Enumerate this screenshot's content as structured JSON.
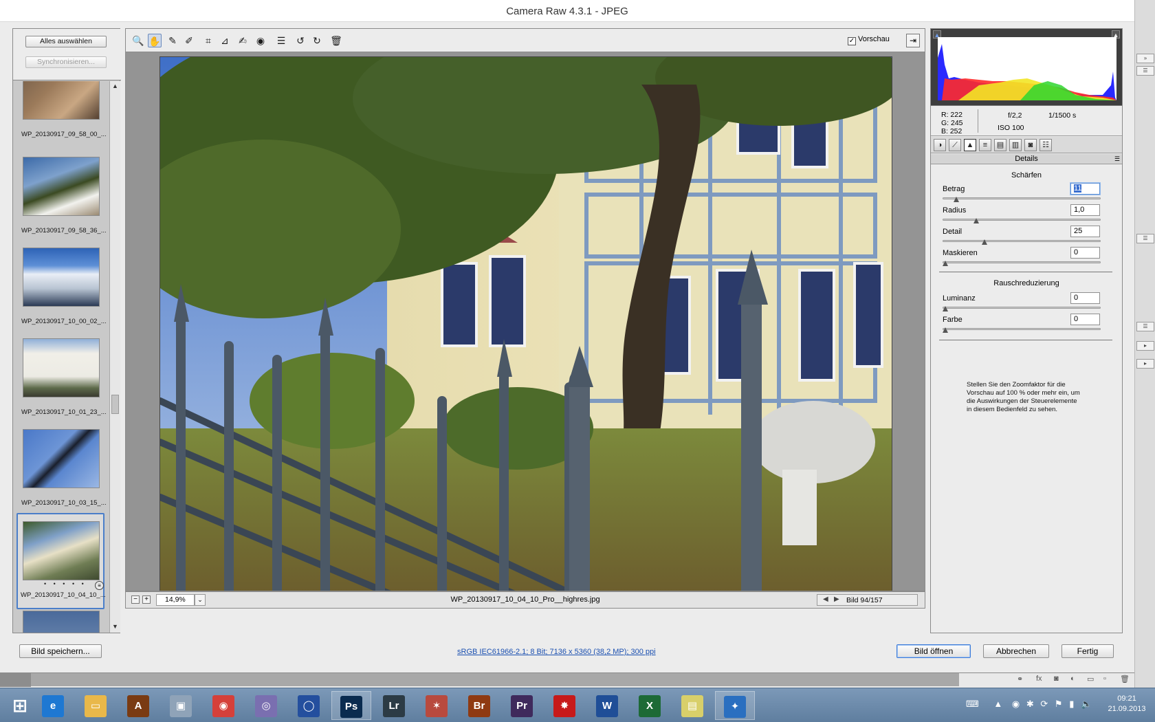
{
  "window": {
    "title": "Camera Raw 4.3.1 - JPEG"
  },
  "filmstrip": {
    "select_all_label": "Alles auswählen",
    "sync_label": "Synchronisieren...",
    "items": [
      {
        "name": "WP_20130917_09_58_00_..."
      },
      {
        "name": "WP_20130917_09_58_36_..."
      },
      {
        "name": "WP_20130917_10_00_02_..."
      },
      {
        "name": "WP_20130917_10_01_23_..."
      },
      {
        "name": "WP_20130917_10_03_15_..."
      },
      {
        "name": "WP_20130917_10_04_10_...",
        "selected": true,
        "stars": "• • • • •"
      }
    ]
  },
  "toolbar": {
    "tools": [
      {
        "name": "zoom-tool",
        "icon": "magnifier-icon",
        "glyph": "🔍"
      },
      {
        "name": "hand-tool",
        "icon": "hand-icon",
        "glyph": "✋"
      },
      {
        "name": "white-balance-tool",
        "icon": "eyedropper-icon",
        "glyph": "✎"
      },
      {
        "name": "color-sampler-tool",
        "icon": "color-sampler-icon",
        "glyph": "✐"
      },
      {
        "name": "crop-tool",
        "icon": "crop-icon",
        "glyph": "⌗"
      },
      {
        "name": "straighten-tool",
        "icon": "straighten-icon",
        "glyph": "⊿"
      },
      {
        "name": "retouch-tool",
        "icon": "retouch-brush-icon",
        "glyph": "✍"
      },
      {
        "name": "red-eye-tool",
        "icon": "red-eye-icon",
        "glyph": "◉"
      },
      {
        "name": "preferences-tool",
        "icon": "list-icon",
        "glyph": "☰"
      },
      {
        "name": "rotate-left-tool",
        "icon": "rotate-left-icon",
        "glyph": "↺"
      },
      {
        "name": "rotate-right-tool",
        "icon": "rotate-right-icon",
        "glyph": "↻"
      },
      {
        "name": "delete-tool",
        "icon": "trash-icon",
        "glyph": "🗑"
      }
    ],
    "preview_label": "Vorschau",
    "preview_checked": true
  },
  "status": {
    "zoom": "14,9%",
    "filename": "WP_20130917_10_04_10_Pro__highres.jpg",
    "image_counter": "Bild 94/157"
  },
  "info": {
    "r": "R:  222",
    "g": "G:  245",
    "b": "B:  252",
    "aperture": "f/2,2",
    "shutter": "1/1500 s",
    "iso": "ISO 100"
  },
  "panel": {
    "title": "Details",
    "sharpen_title": "Schärfen",
    "noise_title": "Rauschreduzierung",
    "controls": [
      {
        "label": "Betrag",
        "value": "11",
        "level": 0.07
      },
      {
        "label": "Radius",
        "value": "1,0",
        "level": 0.2
      },
      {
        "label": "Detail",
        "value": "25",
        "level": 0.25
      },
      {
        "label": "Maskieren",
        "value": "0",
        "level": 0
      },
      {
        "label": "Luminanz",
        "value": "0",
        "level": 0
      },
      {
        "label": "Farbe",
        "value": "0",
        "level": 0
      }
    ],
    "hint": "Stellen Sie den Zoomfaktor für die Vorschau auf 100 % oder mehr ein, um die Auswirkungen der Steuerelemente in diesem Bedienfeld zu sehen."
  },
  "bottom": {
    "save_label": "Bild speichern...",
    "workflow_link": "sRGB IEC61966-2.1; 8 Bit; 7136 x 5360 (38,2 MP); 300 ppi",
    "open_label": "Bild öffnen",
    "cancel_label": "Abbrechen",
    "done_label": "Fertig"
  },
  "taskbar": {
    "apps": [
      {
        "name": "internet-explorer",
        "label": "e",
        "color": "#1e78d2"
      },
      {
        "name": "file-explorer",
        "label": "▭",
        "color": "#e9b84a"
      },
      {
        "name": "app-a",
        "label": "A",
        "color": "#7a3b12"
      },
      {
        "name": "photo-viewer",
        "label": "▣",
        "color": "#8fa3b8"
      },
      {
        "name": "chrome",
        "label": "◉",
        "color": "#d5403a"
      },
      {
        "name": "dvd-player",
        "label": "◎",
        "color": "#7a6fb0"
      },
      {
        "name": "audio-app",
        "label": "◯",
        "color": "#244f9e"
      },
      {
        "name": "photoshop",
        "label": "Ps",
        "color": "#0a2b4f"
      },
      {
        "name": "lightroom",
        "label": "Lr",
        "color": "#2c3b45"
      },
      {
        "name": "app-prism",
        "label": "✶",
        "color": "#b84a3e"
      },
      {
        "name": "bridge",
        "label": "Br",
        "color": "#8f3a12"
      },
      {
        "name": "premiere",
        "label": "Pr",
        "color": "#3f2a5c"
      },
      {
        "name": "app-splash",
        "label": "✸",
        "color": "#c71a1a"
      },
      {
        "name": "word",
        "label": "W",
        "color": "#1f4e97"
      },
      {
        "name": "excel",
        "label": "X",
        "color": "#1d6a36"
      },
      {
        "name": "sticky-notes",
        "label": "▤",
        "color": "#d8cf6a"
      },
      {
        "name": "app-star",
        "label": "✦",
        "color": "#2a6fc0"
      }
    ],
    "time": "09:21",
    "date": "21.09.2013"
  }
}
